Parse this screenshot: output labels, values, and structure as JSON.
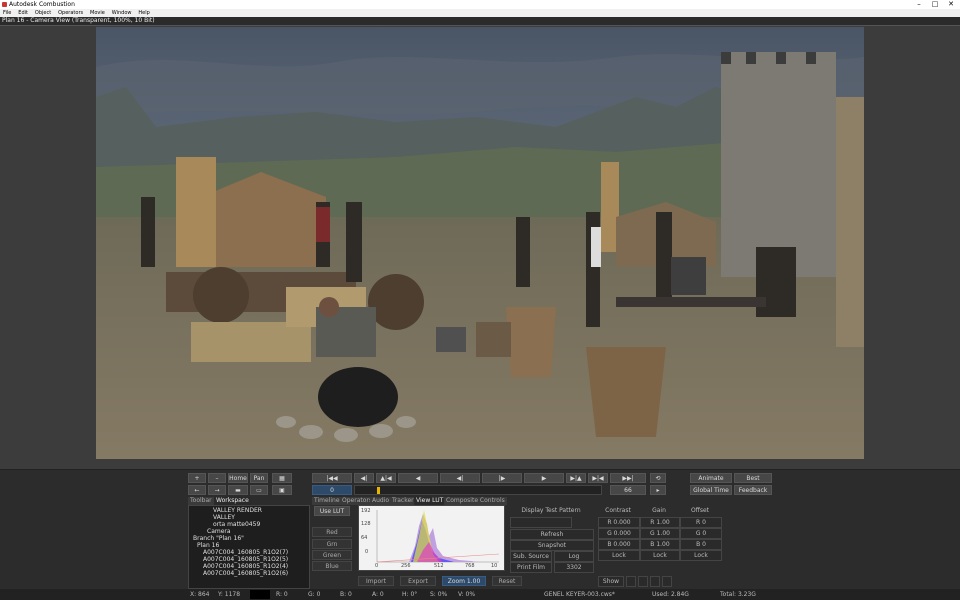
{
  "window": {
    "title": "Autodesk Combustion",
    "minimize": "–",
    "maximize": "□",
    "close": "✕"
  },
  "menu": [
    "File",
    "Edit",
    "Object",
    "Operators",
    "Movie",
    "Window",
    "Help"
  ],
  "viewport": {
    "label": "Plan 16 - Camera View (Transparent, 100%, 10 Bit)"
  },
  "controls": {
    "nav_left": [
      "+",
      "–",
      "Home",
      "Pan"
    ],
    "nav_left2": [
      "←",
      "→"
    ],
    "transport": [
      "|◀◀",
      "◀|",
      "▲|◀",
      "◀",
      "◀|",
      "|▶",
      "▶",
      "▶|▲",
      "▶|◀",
      "▶▶|",
      "⟲"
    ],
    "frame_start": "0",
    "frame_end": "66",
    "animate": "Animate",
    "best": "Best",
    "global_time": "Global Time",
    "feedback": "Feedback"
  },
  "tabs_left": [
    "Toolbar",
    "Workspace"
  ],
  "tree": [
    "VALLEY RENDER",
    "VALLEY",
    "orta matte0459",
    "Camera",
    "Branch \"Plan 16\"",
    "Plan 16",
    "A007C004_160805_R1O2(7)",
    "A007C004_160805_R1O2(5)",
    "A007C004_160805_R1O2(4)",
    "A007C004_160805_R1O2(6)"
  ],
  "tabs_mid": [
    "Timeline",
    "Operators",
    "Audio",
    "Tracker",
    "View LUT",
    "Composite Controls"
  ],
  "lut": {
    "use_lut": "Use LUT",
    "channels": [
      "Red",
      "Grn",
      "Green",
      "Blue"
    ],
    "y_ticks": [
      "192",
      "128",
      "64",
      "0"
    ],
    "x_ticks": [
      "0",
      "256",
      "512",
      "768",
      "10"
    ],
    "bottom": [
      "Import",
      "Export",
      "Zoom 1.00",
      "Reset"
    ]
  },
  "right_panel": {
    "display_pattern": "Display Test Pattern",
    "fields": [
      "Refresh",
      "Snapshot",
      "Sub. Source",
      "Log",
      "Print Film",
      "3302"
    ],
    "cols": [
      "Contrast",
      "Gain",
      "Offset"
    ],
    "values": [
      [
        "R 0.000",
        "R 1.00",
        "R 0"
      ],
      [
        "G 0.000",
        "G 1.00",
        "G 0"
      ],
      [
        "B 0.000",
        "B 1.00",
        "B 0"
      ]
    ],
    "locks": [
      "Lock",
      "Lock",
      "Lock"
    ],
    "show": "Show"
  },
  "status": {
    "x": "X: 864",
    "y": "Y: 1178",
    "r": "R: 0",
    "g": "G: 0",
    "b": "B: 0",
    "a": "A: 0",
    "h": "H: 0°",
    "s": "S: 0%",
    "v": "V: 0%",
    "file": "GENEL KEYER-003.cws*",
    "used": "Used: 2.84G",
    "total": "Total: 3.23G"
  },
  "colors": {
    "accent": "#2d4a6a",
    "marker": "#e8b400"
  }
}
